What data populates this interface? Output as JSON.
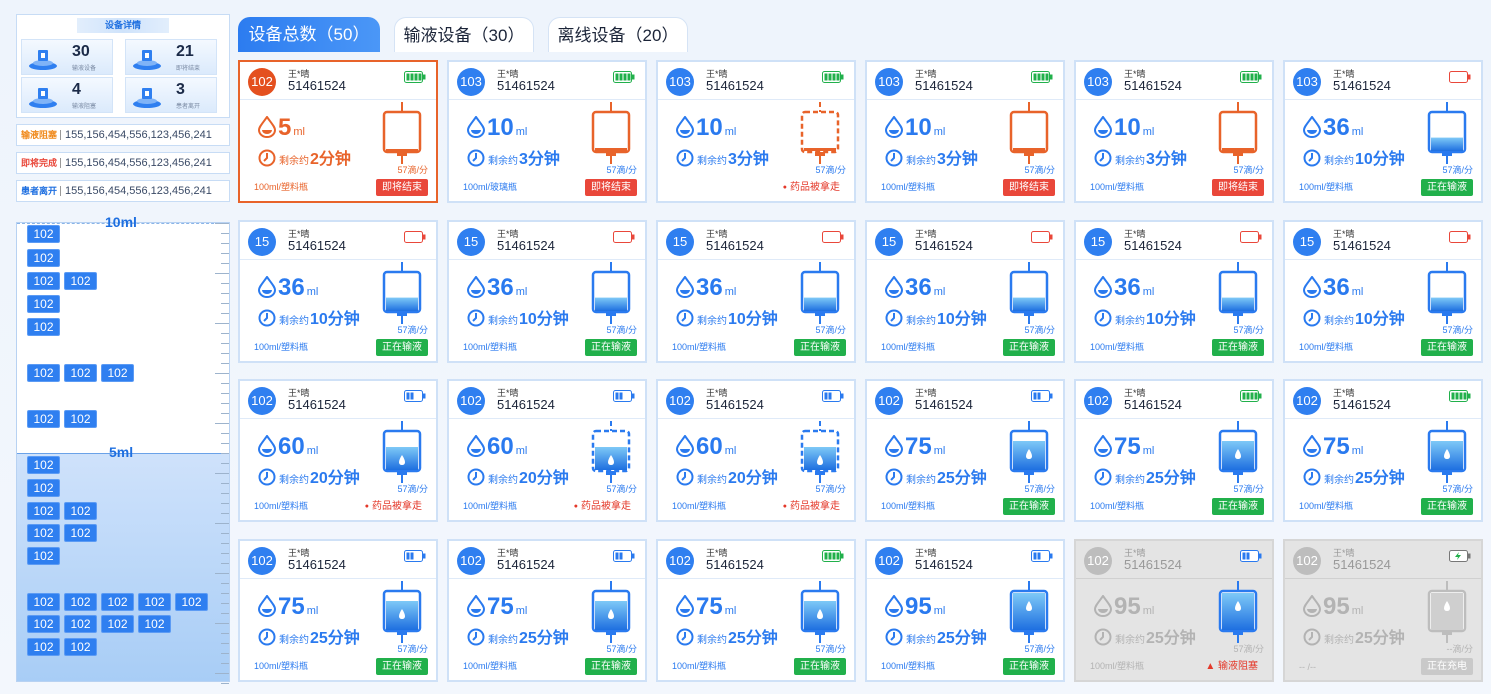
{
  "summary": {
    "title": "设备详情",
    "stats": [
      {
        "num": "30",
        "label": "输液设备"
      },
      {
        "num": "21",
        "label": "即将结束"
      },
      {
        "num": "4",
        "label": "输液阻塞"
      },
      {
        "num": "3",
        "label": "患者离开"
      }
    ],
    "legends": [
      {
        "tag": "输液阻塞",
        "value": "155,156,454,556,123,456,241",
        "color": "#f08a1c"
      },
      {
        "tag": "即将完成",
        "value": "155,156,454,556,123,456,241",
        "color": "#e9473a"
      },
      {
        "tag": "患者离开",
        "value": "155,156,454,556,123,456,241",
        "color": "#1e6fe0"
      }
    ]
  },
  "ruler": {
    "top_label": "10ml",
    "mid_label": "5ml",
    "chip_text": "102",
    "rows": [
      1,
      1,
      2,
      1,
      1,
      0,
      3,
      0,
      2,
      0,
      1,
      1,
      2,
      2,
      1,
      0,
      5,
      4,
      2
    ]
  },
  "tabs": [
    {
      "label": "设备总数（50）",
      "active": true
    },
    {
      "label": "输液设备（30）",
      "active": false
    },
    {
      "label": "离线设备（20）",
      "active": false
    }
  ],
  "card_common": {
    "name": "王*晴",
    "pid": "51461524",
    "remain_prefix": "剩余约",
    "unit": "ml"
  },
  "cards": [
    {
      "bed": "102",
      "vol": "5",
      "time": "2分钟",
      "rate": "57滴/分",
      "spec": "100ml/塑料瓶",
      "status": "即将结束",
      "stype": "ending",
      "state": "alert",
      "batt": "full",
      "bag": "low-orange",
      "level": 0.05
    },
    {
      "bed": "103",
      "vol": "10",
      "time": "3分钟",
      "rate": "57滴/分",
      "spec": "100ml/玻璃瓶",
      "status": "即将结束",
      "stype": "ending",
      "state": "normal",
      "batt": "full",
      "bag": "low-orange",
      "level": 0.1
    },
    {
      "bed": "103",
      "vol": "10",
      "time": "3分钟",
      "rate": "57滴/分",
      "spec": "",
      "status": "药品被拿走",
      "stype": "taken",
      "state": "normal",
      "batt": "full",
      "bag": "dashed-orange",
      "level": 0.1
    },
    {
      "bed": "103",
      "vol": "10",
      "time": "3分钟",
      "rate": "57滴/分",
      "spec": "100ml/塑料瓶",
      "status": "即将结束",
      "stype": "ending",
      "state": "normal",
      "batt": "full",
      "bag": "low-orange",
      "level": 0.1
    },
    {
      "bed": "103",
      "vol": "10",
      "time": "3分钟",
      "rate": "57滴/分",
      "spec": "100ml/塑料瓶",
      "status": "即将结束",
      "stype": "ending",
      "state": "normal",
      "batt": "full",
      "bag": "low-orange",
      "level": 0.1
    },
    {
      "bed": "103",
      "vol": "36",
      "time": "10分钟",
      "rate": "57滴/分",
      "spec": "100ml/塑料瓶",
      "status": "正在输液",
      "stype": "running",
      "state": "normal",
      "batt": "empty",
      "bag": "blue",
      "level": 0.36
    },
    {
      "bed": "15",
      "vol": "36",
      "time": "10分钟",
      "rate": "57滴/分",
      "spec": "100ml/塑料瓶",
      "status": "正在输液",
      "stype": "running",
      "state": "normal",
      "batt": "empty",
      "bag": "blue",
      "level": 0.36
    },
    {
      "bed": "15",
      "vol": "36",
      "time": "10分钟",
      "rate": "57滴/分",
      "spec": "100ml/塑料瓶",
      "status": "正在输液",
      "stype": "running",
      "state": "normal",
      "batt": "empty",
      "bag": "blue",
      "level": 0.36
    },
    {
      "bed": "15",
      "vol": "36",
      "time": "10分钟",
      "rate": "57滴/分",
      "spec": "100ml/塑料瓶",
      "status": "正在输液",
      "stype": "running",
      "state": "normal",
      "batt": "empty",
      "bag": "blue",
      "level": 0.36
    },
    {
      "bed": "15",
      "vol": "36",
      "time": "10分钟",
      "rate": "57滴/分",
      "spec": "100ml/塑料瓶",
      "status": "正在输液",
      "stype": "running",
      "state": "normal",
      "batt": "empty",
      "bag": "blue",
      "level": 0.36
    },
    {
      "bed": "15",
      "vol": "36",
      "time": "10分钟",
      "rate": "57滴/分",
      "spec": "100ml/塑料瓶",
      "status": "正在输液",
      "stype": "running",
      "state": "normal",
      "batt": "empty",
      "bag": "blue",
      "level": 0.36
    },
    {
      "bed": "15",
      "vol": "36",
      "time": "10分钟",
      "rate": "57滴/分",
      "spec": "100ml/塑料瓶",
      "status": "正在输液",
      "stype": "running",
      "state": "normal",
      "batt": "empty",
      "bag": "blue",
      "level": 0.36
    },
    {
      "bed": "102",
      "vol": "60",
      "time": "20分钟",
      "rate": "57滴/分",
      "spec": "100ml/塑料瓶",
      "status": "药品被拿走",
      "stype": "taken",
      "state": "normal",
      "batt": "half",
      "bag": "blue",
      "level": 0.6
    },
    {
      "bed": "102",
      "vol": "60",
      "time": "20分钟",
      "rate": "57滴/分",
      "spec": "100ml/塑料瓶",
      "status": "药品被拿走",
      "stype": "taken",
      "state": "normal",
      "batt": "half",
      "bag": "dashed-blue",
      "level": 0.6
    },
    {
      "bed": "102",
      "vol": "60",
      "time": "20分钟",
      "rate": "57滴/分",
      "spec": "100ml/塑料瓶",
      "status": "药品被拿走",
      "stype": "taken",
      "state": "normal",
      "batt": "half",
      "bag": "dashed-blue",
      "level": 0.6
    },
    {
      "bed": "102",
      "vol": "75",
      "time": "25分钟",
      "rate": "57滴/分",
      "spec": "100ml/塑料瓶",
      "status": "正在输液",
      "stype": "running",
      "state": "normal",
      "batt": "half",
      "bag": "blue",
      "level": 0.75
    },
    {
      "bed": "102",
      "vol": "75",
      "time": "25分钟",
      "rate": "57滴/分",
      "spec": "100ml/塑料瓶",
      "status": "正在输液",
      "stype": "running",
      "state": "normal",
      "batt": "full",
      "bag": "blue",
      "level": 0.75
    },
    {
      "bed": "102",
      "vol": "75",
      "time": "25分钟",
      "rate": "57滴/分",
      "spec": "100ml/塑料瓶",
      "status": "正在输液",
      "stype": "running",
      "state": "normal",
      "batt": "full",
      "bag": "blue",
      "level": 0.75
    },
    {
      "bed": "102",
      "vol": "75",
      "time": "25分钟",
      "rate": "57滴/分",
      "spec": "100ml/塑料瓶",
      "status": "正在输液",
      "stype": "running",
      "state": "normal",
      "batt": "half",
      "bag": "blue",
      "level": 0.75
    },
    {
      "bed": "102",
      "vol": "75",
      "time": "25分钟",
      "rate": "57滴/分",
      "spec": "100ml/塑料瓶",
      "status": "正在输液",
      "stype": "running",
      "state": "normal",
      "batt": "half",
      "bag": "blue",
      "level": 0.75
    },
    {
      "bed": "102",
      "vol": "75",
      "time": "25分钟",
      "rate": "57滴/分",
      "spec": "100ml/塑料瓶",
      "status": "正在输液",
      "stype": "running",
      "state": "normal",
      "batt": "full",
      "bag": "blue",
      "level": 0.75
    },
    {
      "bed": "102",
      "vol": "95",
      "time": "25分钟",
      "rate": "57滴/分",
      "spec": "100ml/塑料瓶",
      "status": "正在输液",
      "stype": "running",
      "state": "normal",
      "batt": "half",
      "bag": "blue",
      "level": 0.95
    },
    {
      "bed": "102",
      "vol": "95",
      "time": "25分钟",
      "rate": "57滴/分",
      "spec": "100ml/塑料瓶",
      "status": "输液阻塞",
      "stype": "blocked",
      "state": "disabled",
      "batt": "half",
      "bag": "blue",
      "level": 0.95
    },
    {
      "bed": "102",
      "vol": "95",
      "time": "25分钟",
      "rate": "--滴/分",
      "spec": "-- /--",
      "status": "正在充电",
      "stype": "charging",
      "state": "disabled",
      "batt": "charging",
      "bag": "grey",
      "level": 0.95
    }
  ],
  "colors": {
    "blue": "#2a7aef",
    "orange": "#e8632a",
    "green": "#21b04b",
    "red": "#e9473a"
  }
}
